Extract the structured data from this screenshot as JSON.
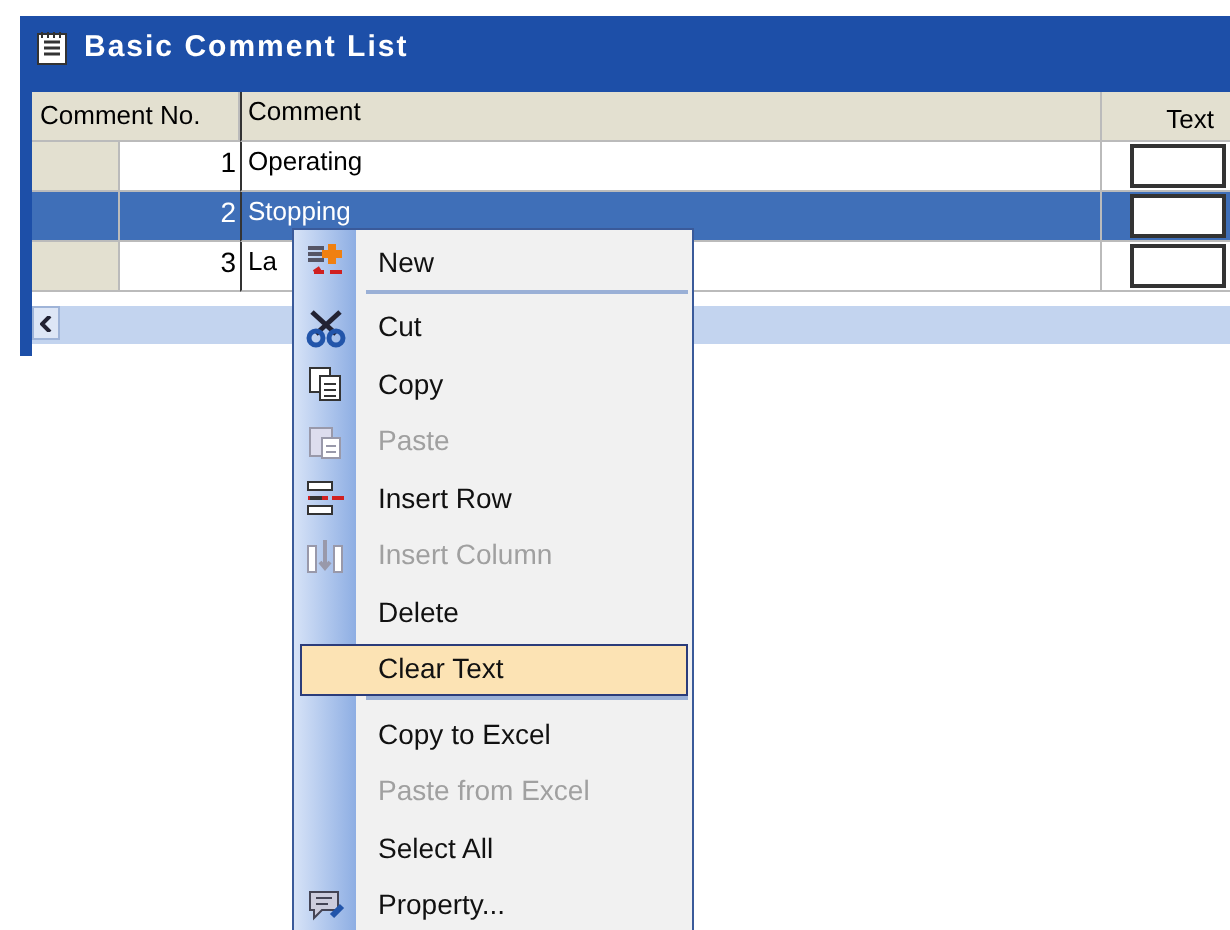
{
  "window": {
    "title": "Basic Comment List"
  },
  "table": {
    "columns": [
      "Comment No.",
      "Comment",
      "Text"
    ],
    "rows": [
      {
        "number": "1",
        "comment": "Operating",
        "selected": false
      },
      {
        "number": "2",
        "comment": "Stopping",
        "selected": true
      },
      {
        "number": "3",
        "comment": "La",
        "selected": false
      }
    ]
  },
  "context_menu": {
    "items": [
      {
        "label": "New",
        "kind": "new",
        "disabled": false,
        "highlighted": false,
        "separator_after": true
      },
      {
        "label": "Cut",
        "kind": "cut",
        "disabled": false,
        "highlighted": false,
        "separator_after": false
      },
      {
        "label": "Copy",
        "kind": "copy",
        "disabled": false,
        "highlighted": false,
        "separator_after": false
      },
      {
        "label": "Paste",
        "kind": "paste",
        "disabled": true,
        "highlighted": false,
        "separator_after": false
      },
      {
        "label": "Insert Row",
        "kind": "insert_row",
        "disabled": false,
        "highlighted": false,
        "separator_after": false
      },
      {
        "label": "Insert Column",
        "kind": "insert_column",
        "disabled": true,
        "highlighted": false,
        "separator_after": false
      },
      {
        "label": "Delete",
        "kind": "plain",
        "disabled": false,
        "highlighted": false,
        "separator_after": false
      },
      {
        "label": "Clear Text",
        "kind": "plain",
        "disabled": false,
        "highlighted": true,
        "separator_after": true
      },
      {
        "label": "Copy to Excel",
        "kind": "plain",
        "disabled": false,
        "highlighted": false,
        "separator_after": false
      },
      {
        "label": "Paste from Excel",
        "kind": "plain",
        "disabled": true,
        "highlighted": false,
        "separator_after": false
      },
      {
        "label": "Select All",
        "kind": "plain",
        "disabled": false,
        "highlighted": false,
        "separator_after": false
      },
      {
        "label": "Property...",
        "kind": "property",
        "disabled": false,
        "highlighted": false,
        "separator_after": false
      }
    ]
  }
}
